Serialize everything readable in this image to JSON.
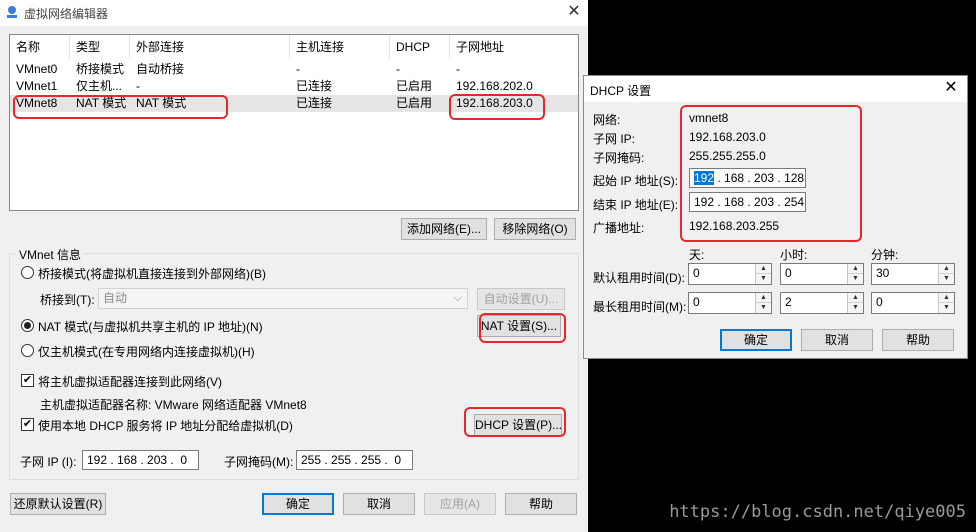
{
  "main_window": {
    "title": "虚拟网络编辑器",
    "close_label": "✕",
    "columns": [
      "名称",
      "类型",
      "外部连接",
      "主机连接",
      "DHCP",
      "子网地址"
    ],
    "networks": [
      {
        "name": "VMnet0",
        "type": "桥接模式",
        "external": "自动桥接",
        "host": "-",
        "dhcp": "-",
        "subnet": "-"
      },
      {
        "name": "VMnet1",
        "type": "仅主机...",
        "external": "-",
        "host": "已连接",
        "dhcp": "已启用",
        "subnet": "192.168.202.0"
      },
      {
        "name": "VMnet8",
        "type": "NAT 模式",
        "external": "NAT 模式",
        "host": "已连接",
        "dhcp": "已启用",
        "subnet": "192.168.203.0"
      }
    ],
    "add_network_button": "添加网络(E)...",
    "remove_network_button": "移除网络(O)",
    "vmnet_info_label": "VMnet 信息",
    "bridged_mode_label": "桥接模式(将虚拟机直接连接到外部网络)(B)",
    "bridged_to_label": "桥接到(T):",
    "bridged_to_value": "自动",
    "auto_settings_button": "自动设置(U)...",
    "nat_mode_label": "NAT 模式(与虚拟机共享主机的 IP 地址)(N)",
    "nat_settings_button": "NAT 设置(S)...",
    "host_only_label": "仅主机模式(在专用网络内连接虚拟机)(H)",
    "connect_adapter_label": "将主机虚拟适配器连接到此网络(V)",
    "adapter_name_label": "主机虚拟适配器名称: VMware 网络适配器 VMnet8",
    "use_dhcp_label": "使用本地 DHCP 服务将 IP 地址分配给虚拟机(D)",
    "dhcp_settings_button": "DHCP 设置(P)...",
    "subnet_ip_label": "子网 IP (I):",
    "subnet_ip_value": "192 . 168 . 203 .  0",
    "subnet_mask_label": "子网掩码(M):",
    "subnet_mask_value": "255 . 255 . 255 .  0",
    "restore_defaults_button": "还原默认设置(R)",
    "ok_button": "确定",
    "cancel_button": "取消",
    "apply_button": "应用(A)",
    "help_button": "帮助",
    "selected_mode": "nat",
    "connect_adapter_checked": true,
    "use_dhcp_checked": true
  },
  "dhcp_dialog": {
    "title": "DHCP 设置",
    "close_label": "✕",
    "network_label": "网络:",
    "network_value": "vmnet8",
    "subnet_ip_label": "子网 IP:",
    "subnet_ip_value": "192.168.203.0",
    "subnet_mask_label": "子网掩码:",
    "subnet_mask_value": "255.255.255.0",
    "start_ip_label": "起始 IP 地址(S):",
    "start_ip_first": "192",
    "start_ip_rest": " . 168 . 203 . 128",
    "end_ip_label": "结束 IP 地址(E):",
    "end_ip_value": "192 . 168 . 203 . 254",
    "broadcast_label": "广播地址:",
    "broadcast_value": "192.168.203.255",
    "days_label": "天:",
    "hours_label": "小时:",
    "minutes_label": "分钟:",
    "default_lease_label": "默认租用时间(D):",
    "default_lease": {
      "days": "0",
      "hours": "0",
      "minutes": "30"
    },
    "max_lease_label": "最长租用时间(M):",
    "max_lease": {
      "days": "0",
      "hours": "2",
      "minutes": "0"
    },
    "ok_button": "确定",
    "cancel_button": "取消",
    "help_button": "帮助"
  },
  "watermark": "https://blog.csdn.net/qiye005",
  "colors": {
    "annotation": "#e8262b",
    "focus_blue": "#0078d7",
    "selection": "#e5e5e5"
  }
}
